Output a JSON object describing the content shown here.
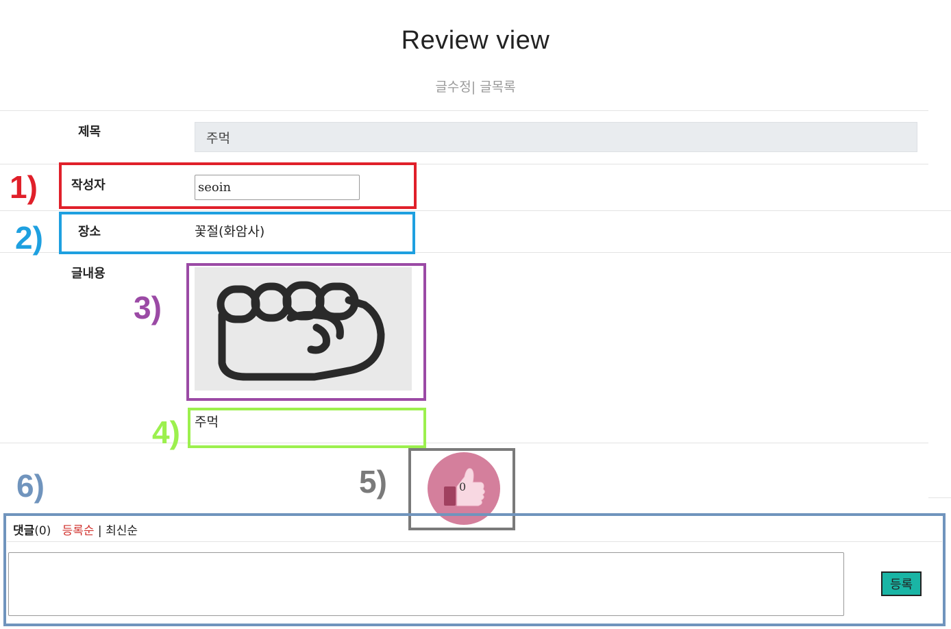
{
  "header": {
    "title": "Review view",
    "edit_link": "글수정",
    "separator": "|",
    "list_link": "글목록"
  },
  "form": {
    "title_label": "제목",
    "title_value": "주먹",
    "writer_label": "작성자",
    "writer_value": "seoin",
    "place_label": "장소",
    "place_value": "꽃절(화암사)",
    "content_label": "글내용",
    "content_text": "주먹"
  },
  "like": {
    "count": "0"
  },
  "comments": {
    "heading": "댓글",
    "count_text": "(0)",
    "sort_registered": "등록순",
    "sort_separator": "|",
    "sort_latest": "최신순",
    "submit_label": "등록"
  },
  "annotations": [
    {
      "label": "1)",
      "color": "#e0202a"
    },
    {
      "label": "2)",
      "color": "#1ea0e0"
    },
    {
      "label": "3)",
      "color": "#9b4aa5"
    },
    {
      "label": "4)",
      "color": "#9cf04e"
    },
    {
      "label": "5)",
      "color": "#7a7a7a"
    },
    {
      "label": "6)",
      "color": "#7094bd"
    }
  ],
  "colors": {
    "like_circle": "#d47f9c",
    "submit_button": "#1ab5a5",
    "sort_active": "#d0312d"
  }
}
